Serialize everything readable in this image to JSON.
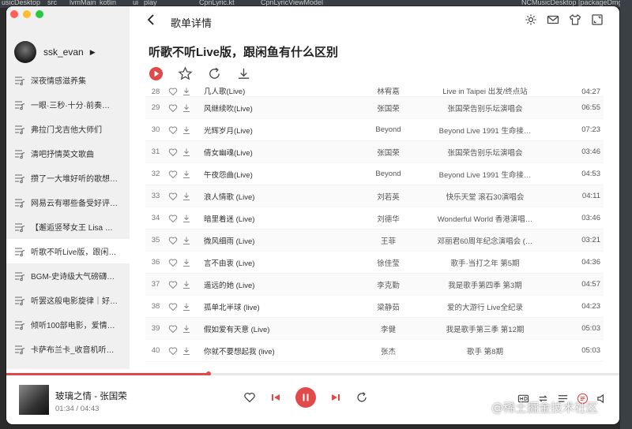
{
  "desktop_bar": [
    "usicDesktop",
    "src",
    "lvmMain",
    "kotlin",
    "ui",
    "play",
    "CpnLyric.kt",
    "CpnLyricViewModel",
    "NCMusicDesktop [packageDmg]"
  ],
  "user": {
    "name": "ssk_evan"
  },
  "sidebar": {
    "playlists": [
      {
        "label": "深夜情感滋养集"
      },
      {
        "label": "一眼·三秒·十分·前奏…"
      },
      {
        "label": "弗拉门戈吉他大师们"
      },
      {
        "label": "清吧抒情英文歌曲"
      },
      {
        "label": "攒了一大堆好听的歌想…"
      },
      {
        "label": "网易云有哪些备受好评…"
      },
      {
        "label": "【邂逅竖琴女王 Lisa …"
      },
      {
        "label": "听歌不听Live版，跟闲…",
        "active": true
      },
      {
        "label": "BGM-史诗级大气磅礴…"
      },
      {
        "label": "听罢这般电影旋律｜好…"
      },
      {
        "label": "倾听100部电影，爱情…"
      },
      {
        "label": "卡萨布兰卡_收音机听…"
      }
    ]
  },
  "header": {
    "title": "歌单详情"
  },
  "playlist": {
    "title": "听歌不听Live版，跟闲鱼有什么区别"
  },
  "songs": [
    {
      "idx": "28",
      "name": "几人歌(Live)",
      "artist": "林宥嘉",
      "album": "Live in Taipei 出发/终点站",
      "time": "04:27"
    },
    {
      "idx": "29",
      "name": "风继续吹(Live)",
      "artist": "张国荣",
      "album": "张国荣告别乐坛演唱会",
      "time": "06:55"
    },
    {
      "idx": "30",
      "name": "光辉岁月(Live)",
      "artist": "Beyond",
      "album": "Beyond Live 1991 生命接…",
      "time": "07:23"
    },
    {
      "idx": "31",
      "name": "倩女幽魂(Live)",
      "artist": "张国荣",
      "album": "张国荣告别乐坛演唱会",
      "time": "03:46"
    },
    {
      "idx": "32",
      "name": "午夜怨曲(Live)",
      "artist": "Beyond",
      "album": "Beyond Live 1991 生命接…",
      "time": "04:53"
    },
    {
      "idx": "33",
      "name": "浪人情歌 (Live)",
      "artist": "刘若英",
      "album": "快乐天堂 滚石30演唱会",
      "time": "04:11"
    },
    {
      "idx": "34",
      "name": "暗里着迷 (Live)",
      "artist": "刘德华",
      "album": "Wonderful World 香港演唱…",
      "time": "03:46"
    },
    {
      "idx": "35",
      "name": "微风细雨 (Live)",
      "artist": "王菲",
      "album": "邓丽君60周年纪念演唱会 (…",
      "time": "03:21"
    },
    {
      "idx": "36",
      "name": "言不由衷 (Live)",
      "artist": "徐佳莹",
      "album": "歌手·当打之年 第5期",
      "time": "04:36"
    },
    {
      "idx": "37",
      "name": "遥远的她 (Live)",
      "artist": "李克勤",
      "album": "我是歌手第四季 第3期",
      "time": "04:57"
    },
    {
      "idx": "38",
      "name": "孤单北半球 (live)",
      "artist": "梁静茹",
      "album": "爱的大游行 Live全纪录",
      "time": "04:23"
    },
    {
      "idx": "39",
      "name": "假如爱有天意 (Live)",
      "artist": "李健",
      "album": "我是歌手第三季 第12期",
      "time": "05:03"
    },
    {
      "idx": "40",
      "name": "你就不要想起我 (live)",
      "artist": "张杰",
      "album": "歌手 第8期",
      "time": "05:03"
    }
  ],
  "player": {
    "song_title": "玻璃之情 - 张国荣",
    "time": "01:34 / 04:43",
    "progress": 0.33
  },
  "watermark": "@稀土掘金技术社区",
  "colors": {
    "accent": "#e04a4a"
  }
}
